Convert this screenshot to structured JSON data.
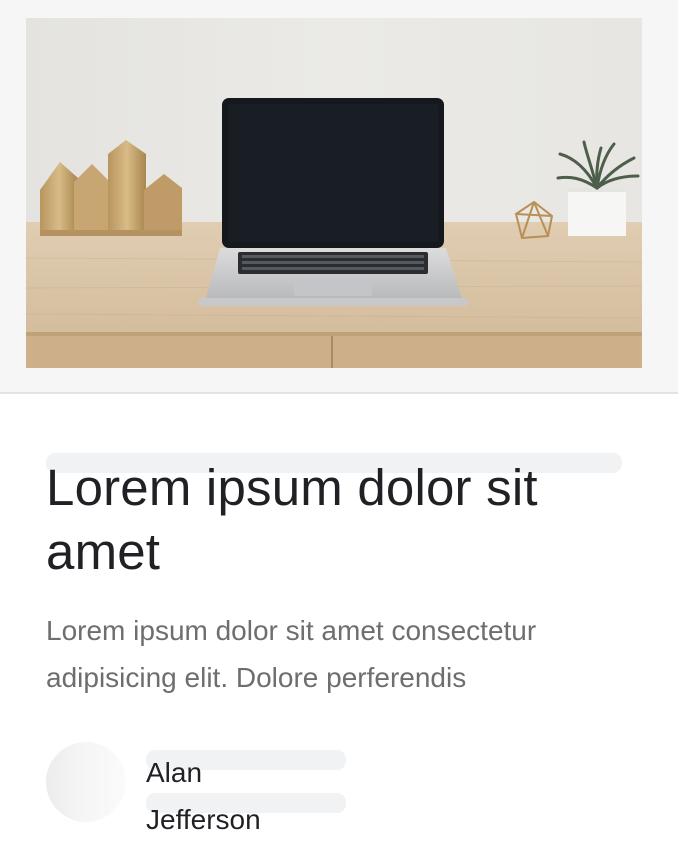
{
  "card": {
    "image_alt": "Laptop on a wooden desk",
    "title": "Lorem ipsum dolor sit amet",
    "description": "Lorem ipsum dolor sit amet consectetur adipisicing elit. Dolore perferendis",
    "author": {
      "first_name": "Alan",
      "last_name": "Jefferson"
    }
  },
  "icons": {
    "avatar": "avatar-placeholder"
  },
  "colors": {
    "title": "#1f2125",
    "description": "#6e6e6e",
    "skeleton": "#f1f2f4",
    "background": "#ffffff",
    "image_frame": "#f6f6f6"
  }
}
